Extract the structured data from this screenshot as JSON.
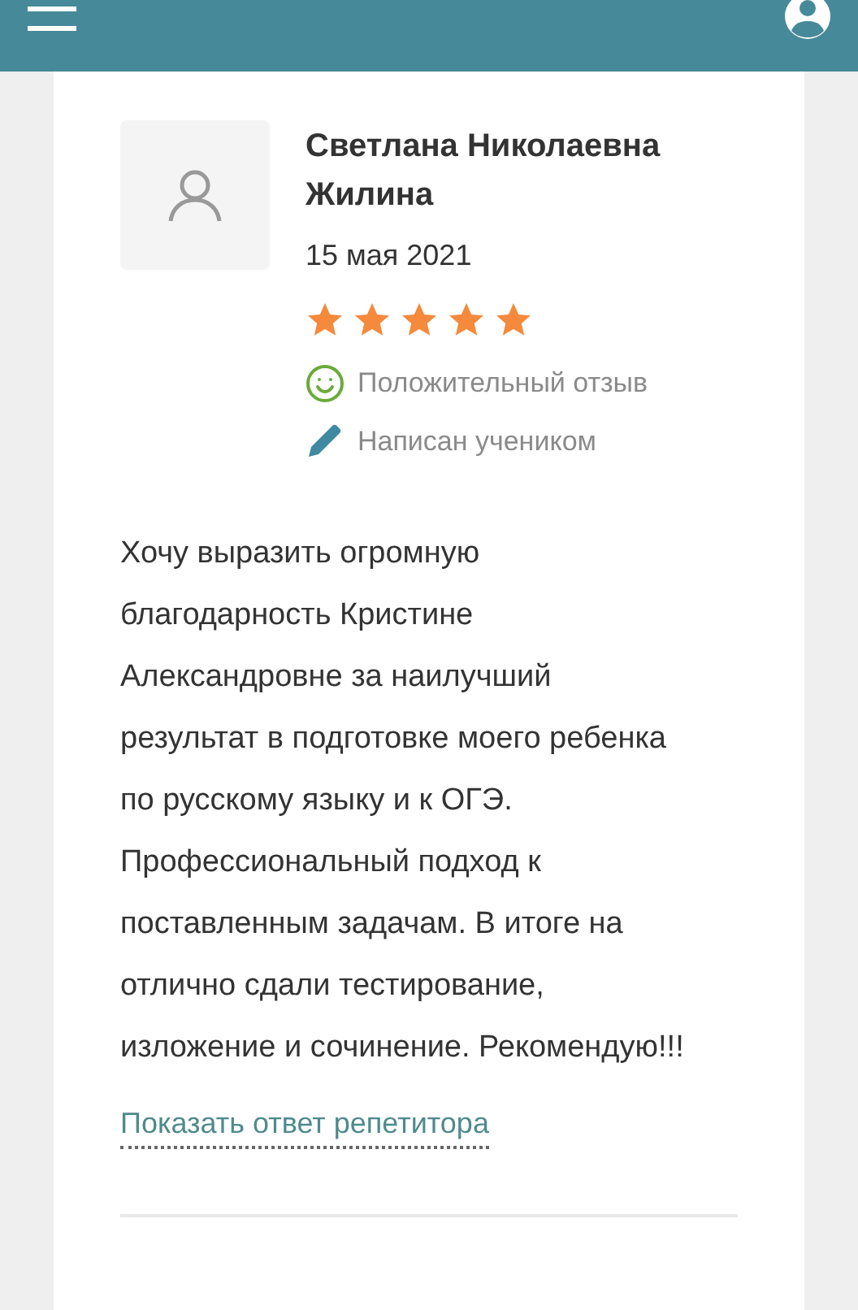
{
  "review": {
    "author": "Светлана Николаевна Жилина",
    "date": "15 мая 2021",
    "stars": 5,
    "tags": [
      {
        "kind": "positive",
        "label": "Положительный отзыв"
      },
      {
        "kind": "student",
        "label": "Написан учеником"
      }
    ],
    "text": "Хочу выразить огромную благодарность Кристине Александровне за наилучший результат в подготовке моего ребенка по русскому языку и к ОГЭ. Профессиональный подход к поставленным задачам. В итоге на отлично сдали тестирование, изложение и сочинение. Рекомендую!!!",
    "reply_link": "Показать ответ репетитора"
  }
}
